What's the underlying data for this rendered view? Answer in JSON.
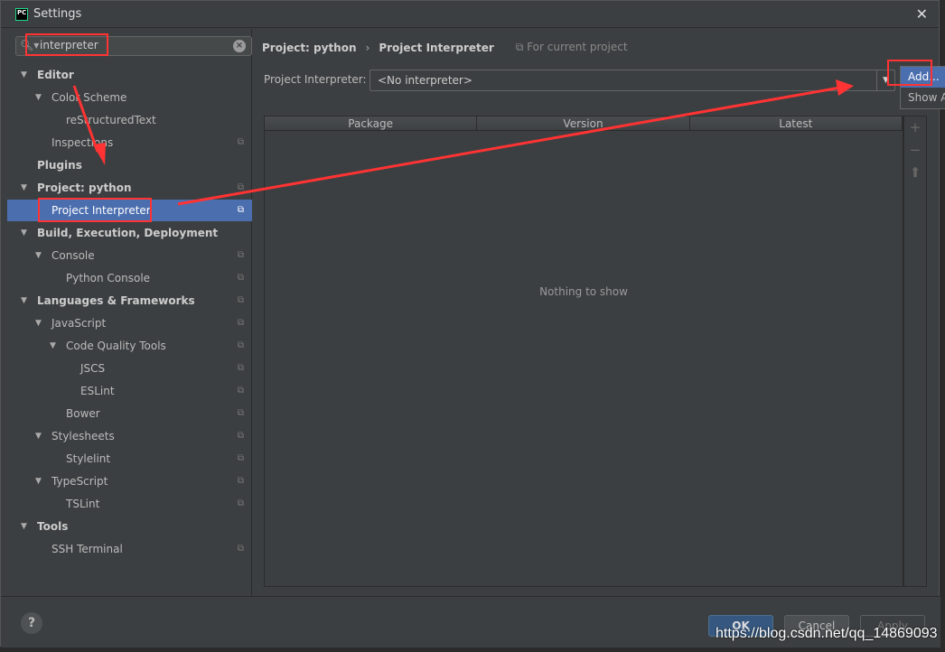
{
  "window": {
    "title": "Settings",
    "logo": "PC"
  },
  "search": {
    "value": "interpreter"
  },
  "tree": [
    {
      "label": "Editor",
      "level": 0,
      "bold": true,
      "arrow": true,
      "copy": false
    },
    {
      "label": "Color Scheme",
      "level": 1,
      "arrow": true,
      "copy": false
    },
    {
      "label": "reStructuredText",
      "level": 2,
      "copy": false
    },
    {
      "label": "Inspections",
      "level": 1,
      "copy": true
    },
    {
      "label": "Plugins",
      "level": 0,
      "bold": true,
      "copy": false
    },
    {
      "label": "Project: python",
      "level": 0,
      "bold": true,
      "arrow": true,
      "copy": true
    },
    {
      "label": "Project Interpreter",
      "level": 1,
      "copy": true,
      "selected": true
    },
    {
      "label": "Build, Execution, Deployment",
      "level": 0,
      "bold": true,
      "arrow": true,
      "copy": false
    },
    {
      "label": "Console",
      "level": 1,
      "arrow": true,
      "copy": true
    },
    {
      "label": "Python Console",
      "level": 2,
      "copy": true
    },
    {
      "label": "Languages & Frameworks",
      "level": 0,
      "bold": true,
      "arrow": true,
      "copy": true
    },
    {
      "label": "JavaScript",
      "level": 1,
      "arrow": true,
      "copy": true
    },
    {
      "label": "Code Quality Tools",
      "level": 2,
      "arrow": true,
      "copy": true
    },
    {
      "label": "JSCS",
      "level": 3,
      "copy": true
    },
    {
      "label": "ESLint",
      "level": 3,
      "copy": true
    },
    {
      "label": "Bower",
      "level": 2,
      "copy": true
    },
    {
      "label": "Stylesheets",
      "level": 1,
      "arrow": true,
      "copy": true
    },
    {
      "label": "Stylelint",
      "level": 2,
      "copy": true
    },
    {
      "label": "TypeScript",
      "level": 1,
      "arrow": true,
      "copy": true
    },
    {
      "label": "TSLint",
      "level": 2,
      "copy": true
    },
    {
      "label": "Tools",
      "level": 0,
      "bold": true,
      "arrow": true,
      "copy": false
    },
    {
      "label": "SSH Terminal",
      "level": 1,
      "copy": true
    }
  ],
  "breadcrumb": {
    "parent": "Project: python",
    "current": "Project Interpreter",
    "scope": "For current project"
  },
  "interpreter": {
    "label": "Project Interpreter:",
    "value": "<No interpreter>"
  },
  "popup": {
    "items": [
      "Add...",
      "Show All..."
    ]
  },
  "table": {
    "columns": [
      "Package",
      "Version",
      "Latest"
    ],
    "empty": "Nothing to show"
  },
  "footer": {
    "ok": "OK",
    "cancel": "Cancel",
    "apply": "Apply",
    "help": "?"
  },
  "watermark": "https://blog.csdn.net/qq_14869093",
  "colors": {
    "selection": "#4b6eaf",
    "annotation": "#ff3333"
  }
}
